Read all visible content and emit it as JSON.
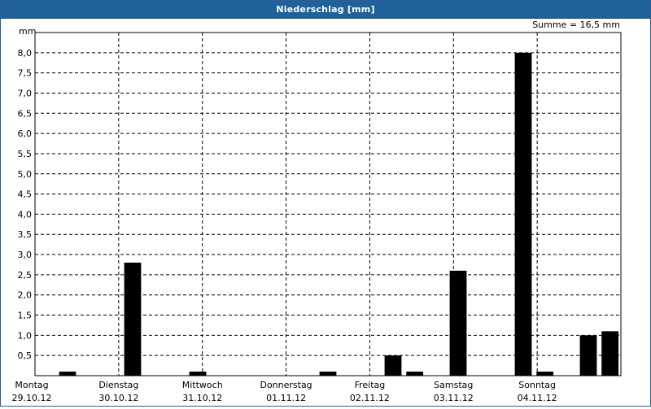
{
  "window": {
    "title": "Niederschlag [mm]"
  },
  "chart_data": {
    "type": "bar",
    "title": "Niederschlag [mm]",
    "ylabel": "mm",
    "summary": "Summe = 16,5 mm",
    "ylim": [
      0,
      8.5
    ],
    "y_ticks": [
      "0,5",
      "1,0",
      "1,5",
      "2,0",
      "2,5",
      "3,0",
      "3,5",
      "4,0",
      "4,5",
      "5,0",
      "5,5",
      "6,0",
      "6,5",
      "7,0",
      "7,5",
      "8,0"
    ],
    "day_labels": [
      {
        "day": "Montag",
        "date": "29.10.12"
      },
      {
        "day": "Dienstag",
        "date": "30.10.12"
      },
      {
        "day": "Mittwoch",
        "date": "31.10.12"
      },
      {
        "day": "Donnerstag",
        "date": "01.11.12"
      },
      {
        "day": "Freitag",
        "date": "02.11.12"
      },
      {
        "day": "Samstag",
        "date": "03.11.12"
      },
      {
        "day": "Sonntag",
        "date": "04.11.12"
      }
    ],
    "interval_hours": 8,
    "values": [
      0,
      0.1,
      0,
      0,
      2.8,
      0,
      0,
      0.1,
      0,
      0,
      0,
      0,
      0,
      0.1,
      0,
      0,
      0.5,
      0.1,
      0,
      2.6,
      0,
      0,
      8.0,
      0.1,
      0,
      1.0,
      1.1
    ],
    "grid": true
  }
}
